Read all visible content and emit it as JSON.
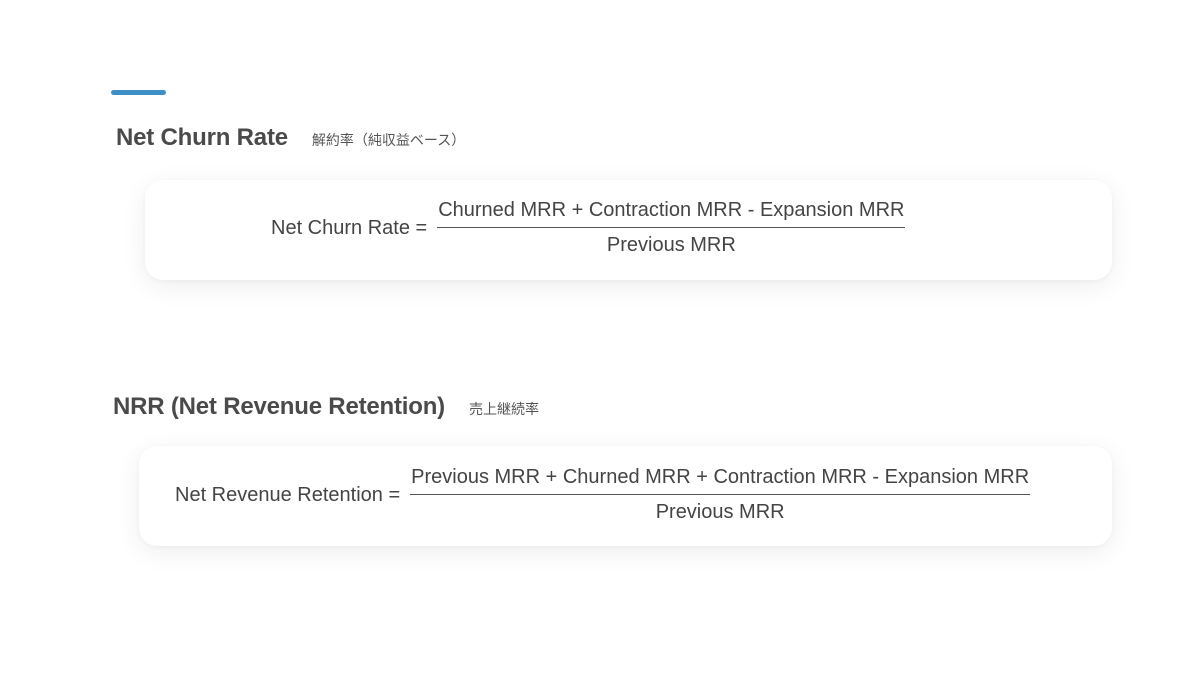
{
  "sections": [
    {
      "title": "Net Churn Rate",
      "subtitle": "解約率（純収益ベース）",
      "formula": {
        "lhs": "Net Churn Rate =",
        "numerator": "Churned MRR + Contraction MRR - Expansion MRR",
        "denominator": "Previous MRR"
      }
    },
    {
      "title": "NRR (Net Revenue Retention)",
      "subtitle": "売上継続率",
      "formula": {
        "lhs": "Net Revenue Retention =",
        "numerator": "Previous MRR + Churned MRR + Contraction MRR - Expansion MRR",
        "denominator": "Previous MRR"
      }
    }
  ],
  "colors": {
    "accent": "#3d8fc6",
    "text": "#444444",
    "heading": "#4a4a4a"
  }
}
